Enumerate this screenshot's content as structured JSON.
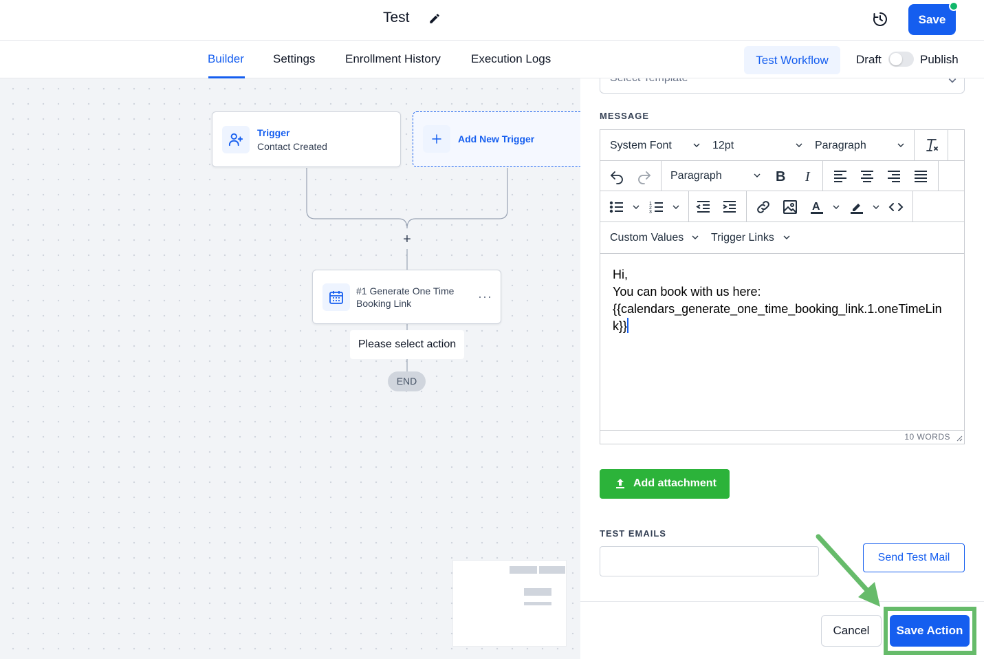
{
  "header": {
    "workflow_title": "Test",
    "save_label": "Save"
  },
  "tabs": [
    {
      "label": "Builder"
    },
    {
      "label": "Settings"
    },
    {
      "label": "Enrollment History"
    },
    {
      "label": "Execution Logs"
    }
  ],
  "toolbar": {
    "test_workflow_label": "Test Workflow",
    "draft_label": "Draft",
    "publish_label": "Publish"
  },
  "canvas": {
    "trigger": {
      "name": "Trigger",
      "event": "Contact Created"
    },
    "add_trigger_label": "Add New Trigger",
    "action": {
      "title": "#1 Generate One Time Booking Link",
      "menu": "···"
    },
    "select_action_label": "Please select action",
    "end_label": "END",
    "add_step_symbol": "+"
  },
  "panel": {
    "template_placeholder": "Select Template",
    "message_label": "MESSAGE",
    "editor": {
      "font_family": "System Font",
      "font_size": "12pt",
      "block_format": "Paragraph",
      "block_format_2": "Paragraph",
      "custom_values_label": "Custom Values",
      "trigger_links_label": "Trigger Links",
      "body_lines": [
        "Hi,",
        "You can book with us here:",
        "{{calendars_generate_one_time_booking_link.1.oneTimeLink}}"
      ],
      "word_count": "10 WORDS"
    },
    "add_attachment_label": "Add attachment",
    "test_emails_label": "TEST EMAILS",
    "test_email_value": "",
    "send_test_mail_label": "Send Test Mail",
    "cancel_label": "Cancel",
    "save_action_label": "Save Action"
  },
  "colors": {
    "primary": "#155eef",
    "success": "#2cb33a",
    "annotation": "#66bb6a"
  }
}
